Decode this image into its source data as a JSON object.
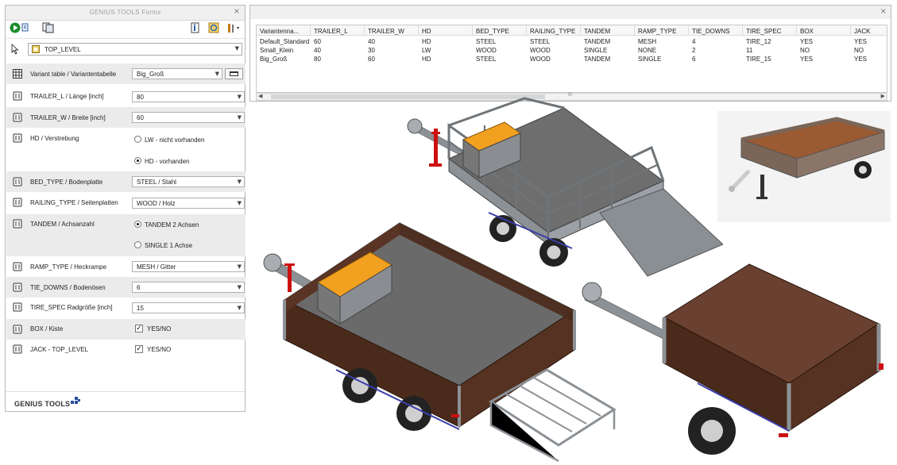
{
  "forms": {
    "title": "GENIUS TOOLS Forms",
    "close": "×",
    "top_level": "TOP_LEVEL",
    "brand": "GENIUS TOOLS",
    "variant_row": {
      "label": "Variant table / Variantentabelle",
      "value": "Big_Groß"
    },
    "params": [
      {
        "label": "TRAILER_L / Länge [inch]",
        "value": "80"
      },
      {
        "label": "TRAILER_W / Breite [inch]",
        "value": "60"
      },
      {
        "label": "HD / Verstrebung",
        "options": [
          "LW - nicht vorhanden",
          "HD - vorhanden"
        ],
        "selected": 1
      },
      {
        "label": "BED_TYPE / Bodenplatte",
        "value": "STEEL / Stahl"
      },
      {
        "label": "RAILING_TYPE / Seitenplatten",
        "value": "WOOD / Holz"
      },
      {
        "label": "TANDEM / Achsanzahl",
        "options": [
          "TANDEM 2 Achsen",
          "SINGLE 1 Achse"
        ],
        "selected": 0
      },
      {
        "label": "RAMP_TYPE / Heckrampe",
        "value": "MESH / Gitter"
      },
      {
        "label": "TIE_DOWNS / Bodenösen",
        "value": "6"
      },
      {
        "label": "TIRE_SPEC Radgröße [inch]",
        "value": "15"
      },
      {
        "label": "BOX / Kiste",
        "checkbox": "YES/NO"
      },
      {
        "label": "JACK - TOP_LEVEL",
        "checkbox": "YES/NO"
      }
    ]
  },
  "table": {
    "close": "×",
    "scroll_grip": "III",
    "columns": [
      "Variantenna...",
      "TRAILER_L",
      "TRAILER_W",
      "HD",
      "BED_TYPE",
      "RAILING_TYPE",
      "TANDEM",
      "RAMP_TYPE",
      "TIE_DOWNS",
      "TIRE_SPEC",
      "BOX",
      "JACK"
    ],
    "rows": [
      [
        "Default_Standard",
        "60",
        "40",
        "HD",
        "STEEL",
        "STEEL",
        "TANDEM",
        "MESH",
        "4",
        "TIRE_12",
        "YES",
        "YES"
      ],
      [
        "Small_Klein",
        "40",
        "30",
        "LW",
        "WOOD",
        "WOOD",
        "SINGLE",
        "NONE",
        "2",
        "11",
        "NO",
        "NO"
      ],
      [
        "Big_Groß",
        "80",
        "60",
        "HD",
        "STEEL",
        "WOOD",
        "TANDEM",
        "SINGLE",
        "6",
        "TIRE_15",
        "YES",
        "YES"
      ]
    ]
  },
  "icons": [
    "run-icon",
    "copy-icon",
    "info-icon",
    "refresh-icon",
    "tools-icon",
    "pointer-icon",
    "part-icon",
    "table-icon",
    "param-icon"
  ],
  "colors": {
    "wood": "#4a2a1a",
    "frame": "#8c9196",
    "box": "#f2a020",
    "jack": "#cc1010",
    "deck": "#6e6e6e"
  }
}
